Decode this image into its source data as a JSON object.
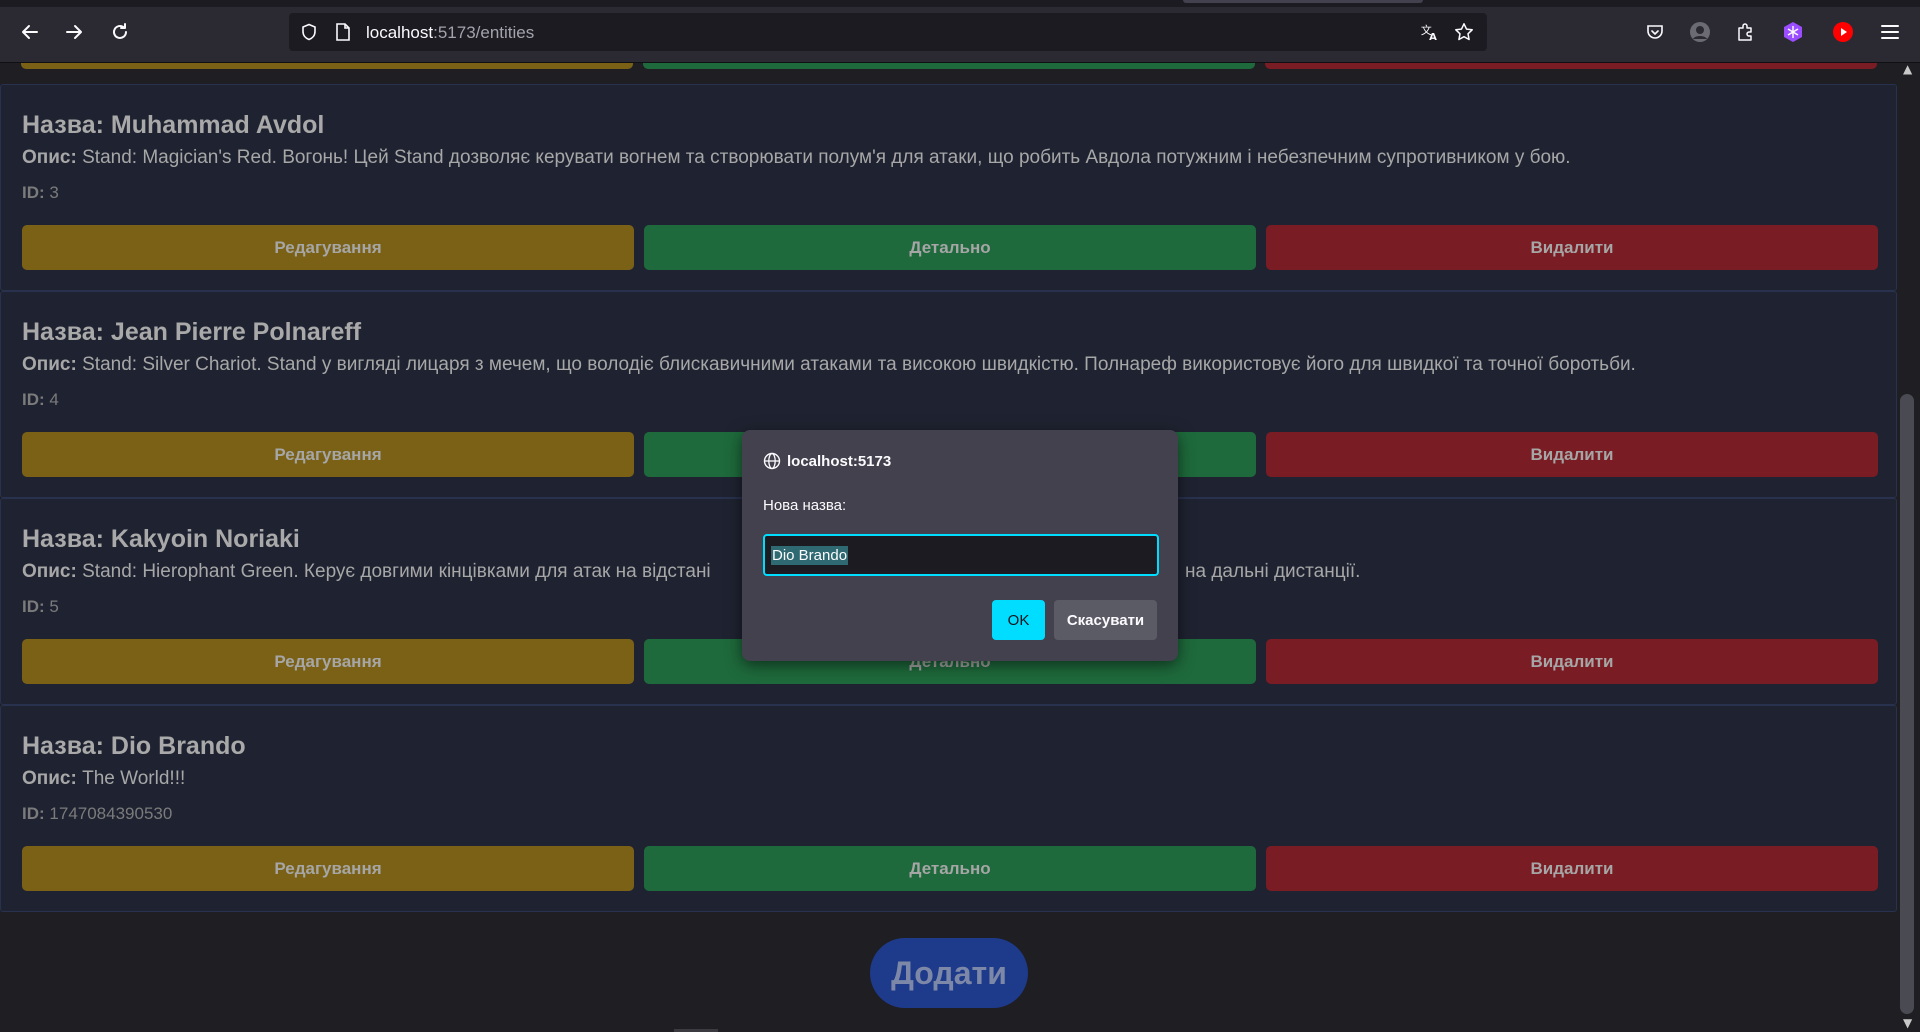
{
  "browser": {
    "url_host": "localhost",
    "url_path": ":5173/entities"
  },
  "labels": {
    "name": "Назва:",
    "description": "Опис:",
    "id": "ID:"
  },
  "buttons": {
    "edit": "Редагування",
    "details": "Детально",
    "delete": "Видалити"
  },
  "entities": [
    {
      "name": "Muhammad Avdol",
      "description": "Stand: Magician's Red. Вогонь! Цей Stand дозволяє керувати вогнем та створювати полум'я для атаки, що робить Авдола потужним і небезпечним супротивником у бою.",
      "id": "3"
    },
    {
      "name": "Jean Pierre Polnareff",
      "description": "Stand: Silver Chariot. Stand у вигляді лицаря з мечем, що володіє блискавичними атаками та високою швидкістю. Полнареф використовує його для швидкої та точної боротьби.",
      "id": "4"
    },
    {
      "name": "Kakyoin Noriaki",
      "description_left": "Stand: Hierophant Green. Керує довгими кінцівками для атак на відстані",
      "description_right": "на дальні дистанції.",
      "id": "5"
    },
    {
      "name": "Dio Brando",
      "description": "The World!!!",
      "id": "1747084390530"
    }
  ],
  "add_button": "Додати",
  "dialog": {
    "origin": "localhost:5173",
    "message": "Нова назва:",
    "input_value": "Dio Brando",
    "ok": "OK",
    "cancel": "Скасувати"
  },
  "colors": {
    "edit": "#7a6116",
    "details": "#1e6a3c",
    "delete": "#7a1c23",
    "add": "#1e3a8a",
    "dialog_accent": "#00ddff"
  }
}
